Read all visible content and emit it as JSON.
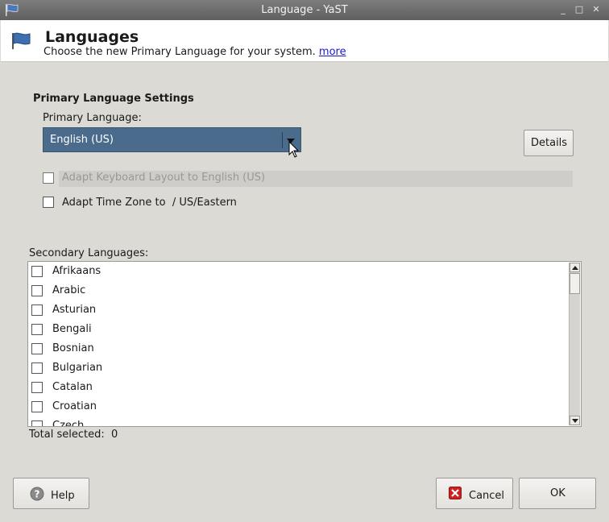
{
  "window": {
    "title": "Language - YaST"
  },
  "header": {
    "title": "Languages",
    "subtitle": "Choose the new Primary Language for your system.",
    "more_link": "more"
  },
  "primary": {
    "section_title": "Primary Language Settings",
    "label": "Primary Language:",
    "selected": "English (US)",
    "details_button": "Details",
    "adapt_keyboard": {
      "label": "Adapt Keyboard Layout to English (US)",
      "checked": false,
      "enabled": false
    },
    "adapt_timezone": {
      "label": "Adapt Time Zone to  / US/Eastern",
      "checked": false,
      "enabled": true
    }
  },
  "secondary": {
    "label": "Secondary Languages:",
    "items": [
      {
        "label": "Afrikaans",
        "checked": false
      },
      {
        "label": "Arabic",
        "checked": false
      },
      {
        "label": "Asturian",
        "checked": false
      },
      {
        "label": "Bengali",
        "checked": false
      },
      {
        "label": "Bosnian",
        "checked": false
      },
      {
        "label": "Bulgarian",
        "checked": false
      },
      {
        "label": "Catalan",
        "checked": false
      },
      {
        "label": "Croatian",
        "checked": false
      },
      {
        "label": "Czech",
        "checked": false
      }
    ],
    "total_label": "Total selected:",
    "total_value": "0"
  },
  "footer": {
    "help": "Help",
    "cancel": "Cancel",
    "ok": "OK"
  },
  "icons": {
    "app": "yast-flag-icon",
    "help": "help-icon",
    "cancel": "cancel-x-icon"
  },
  "colors": {
    "combo_bg": "#4b6b8c",
    "titlebar": "#6e6e6e",
    "link": "#1a1acc",
    "cancel_icon": "#cc2222"
  }
}
